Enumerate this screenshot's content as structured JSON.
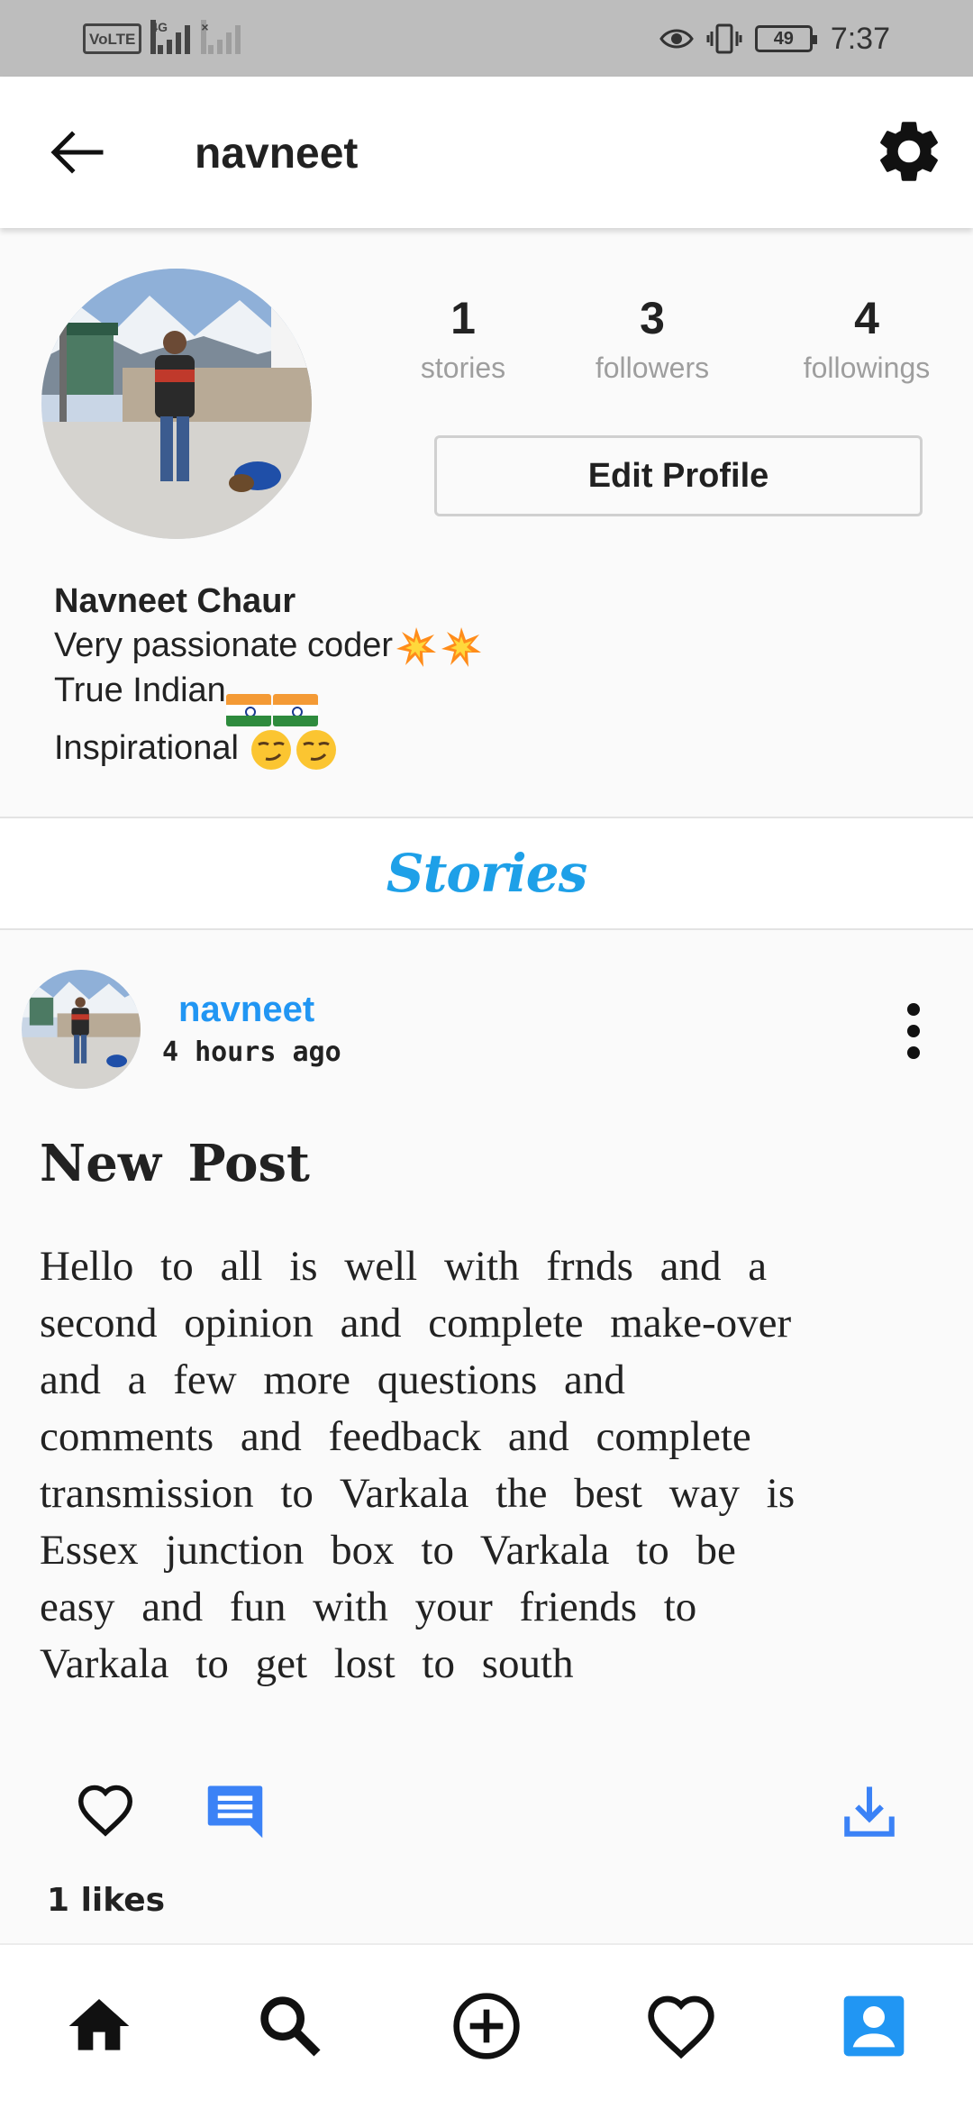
{
  "status_bar": {
    "volte": "VoLTE",
    "network": "4G",
    "battery": "49",
    "time": "7:37"
  },
  "app_bar": {
    "title": "navneet"
  },
  "profile": {
    "stats": [
      {
        "value": "1",
        "label": "stories"
      },
      {
        "value": "3",
        "label": "followers"
      },
      {
        "value": "4",
        "label": "followings"
      }
    ],
    "edit_button": "Edit Profile",
    "name": "Navneet Chaur",
    "bio": [
      "Very passionate coder",
      "True Indian",
      "Inspirational "
    ]
  },
  "stories_label": "Stories",
  "post": {
    "username": "navneet",
    "time": "4 hours ago",
    "title": "New Post",
    "body_lines": [
      "Hello to all is well with frnds and a",
      "second opinion and complete make-over",
      "and a few more questions and",
      "comments and feedback and complete",
      "transmission to Varkala the best way is",
      "Essex junction box to Varkala to be",
      "easy and fun with your friends to",
      "Varkala to get lost to south"
    ],
    "likes": "1 likes"
  },
  "colors": {
    "accent": "#2196f3",
    "stories": "#1ea0e8",
    "status_bar": "#bdbdbd"
  },
  "icons": [
    "back-arrow-icon",
    "gear-icon",
    "more-vert-icon",
    "heart-icon",
    "comment-icon",
    "download-icon",
    "home-icon",
    "search-icon",
    "add-circle-icon",
    "heart-outline-icon",
    "account-box-icon"
  ]
}
